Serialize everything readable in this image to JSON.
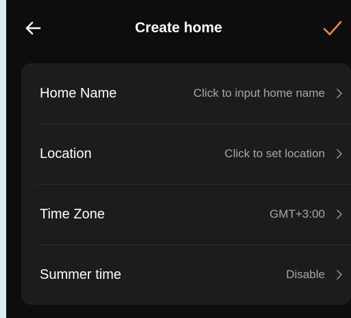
{
  "header": {
    "title": "Create home",
    "back_icon": "arrow-left-icon",
    "confirm_icon": "checkmark-icon",
    "accent_color": "#f08a3c"
  },
  "settings": {
    "rows": [
      {
        "label": "Home Name",
        "value": "Click to input home name"
      },
      {
        "label": "Location",
        "value": "Click to set location"
      },
      {
        "label": "Time Zone",
        "value": "GMT+3:00"
      },
      {
        "label": "Summer time",
        "value": "Disable"
      }
    ],
    "chevron_icon": "chevron-right-icon"
  },
  "colors": {
    "background": "#0d0d0d",
    "card": "#1c1c1e",
    "label": "#ffffff",
    "value": "#a7a7aa",
    "outer": "#dfeef1"
  }
}
